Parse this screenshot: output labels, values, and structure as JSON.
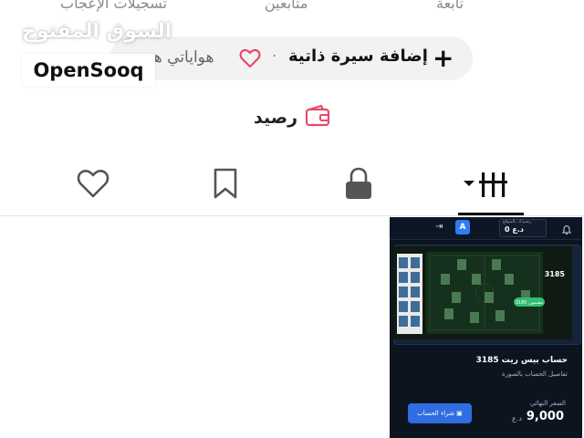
{
  "profile_stats": {
    "likes_label": "تسجيلات الإعجاب",
    "followers_label": "متابعين",
    "following_label": "تابعة"
  },
  "watermark": {
    "arabic": "السوق المفتوح",
    "brand": "OpenSooq"
  },
  "profile_actions": {
    "add_cv_label": "إضافة سيرة ذاتية",
    "separator": "·",
    "hobbies_label": "هواياتي هو"
  },
  "wallet": {
    "label": "رصيد"
  },
  "tabs": [
    {
      "icon": "grid-icon",
      "active": true
    },
    {
      "icon": "lock-icon",
      "active": false
    },
    {
      "icon": "bookmark-icon",
      "active": false
    },
    {
      "icon": "heart-icon",
      "active": false
    }
  ],
  "listing": {
    "header_balance": "0 د.ع",
    "header_balance_hint": "رصيدك بالموقع",
    "avatar_letter": "A",
    "title": "حساب بيس ريت 3185",
    "subtitle": "تفاصيل الحساب بالصورة",
    "final_price_label": "السعر النهائي",
    "price": "9,000",
    "currency": "د.ع",
    "buy_button": "شراء الحساب",
    "team_rating": "3185",
    "guaranteed_badge": "مضمون 3185"
  },
  "colors": {
    "accent_pink": "#e8496a",
    "listing_bg": "#0c1420",
    "buy_blue": "#2f6de0"
  }
}
